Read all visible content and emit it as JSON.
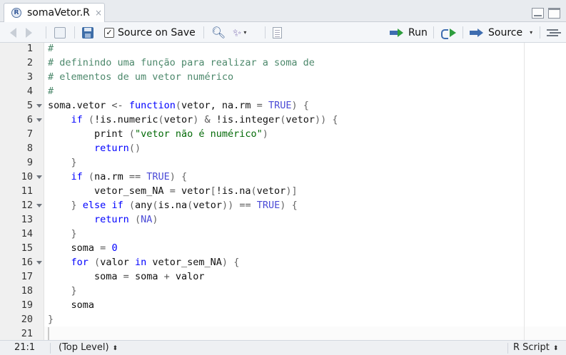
{
  "tab": {
    "icon_letter": "R",
    "title": "somaVetor.R",
    "close_glyph": "×"
  },
  "toolbar": {
    "source_on_save_label": "Source on Save",
    "source_on_save_checked": "✓",
    "run_label": "Run",
    "source_label": "Source",
    "dropdown_caret": "▾"
  },
  "editor": {
    "lines": [
      {
        "num": "1",
        "fold": false,
        "tokens": [
          [
            "c-comment",
            "#"
          ]
        ]
      },
      {
        "num": "2",
        "fold": false,
        "tokens": [
          [
            "c-comment",
            "# definindo uma função para realizar a soma de"
          ]
        ]
      },
      {
        "num": "3",
        "fold": false,
        "tokens": [
          [
            "c-comment",
            "# elementos de um vetor numérico"
          ]
        ]
      },
      {
        "num": "4",
        "fold": false,
        "tokens": [
          [
            "c-comment",
            "#"
          ]
        ]
      },
      {
        "num": "5",
        "fold": true,
        "tokens": [
          [
            "",
            "soma.vetor "
          ],
          [
            "c-op",
            "<-"
          ],
          [
            "",
            " "
          ],
          [
            "c-kw",
            "function"
          ],
          [
            "c-punc",
            "("
          ],
          [
            "",
            "vetor, na.rm "
          ],
          [
            "c-op",
            "="
          ],
          [
            "",
            " "
          ],
          [
            "c-const",
            "TRUE"
          ],
          [
            "c-punc",
            ")"
          ],
          [
            "",
            " "
          ],
          [
            "c-punc",
            "{"
          ]
        ]
      },
      {
        "num": "6",
        "fold": true,
        "tokens": [
          [
            "",
            "    "
          ],
          [
            "c-kw",
            "if"
          ],
          [
            "",
            " "
          ],
          [
            "c-punc",
            "("
          ],
          [
            "",
            "!is.numeric"
          ],
          [
            "c-punc",
            "("
          ],
          [
            "",
            "vetor"
          ],
          [
            "c-punc",
            ")"
          ],
          [
            "",
            " "
          ],
          [
            "c-op",
            "&"
          ],
          [
            "",
            " !is.integer"
          ],
          [
            "c-punc",
            "("
          ],
          [
            "",
            "vetor"
          ],
          [
            "c-punc",
            "))"
          ],
          [
            "",
            " "
          ],
          [
            "c-punc",
            "{"
          ]
        ]
      },
      {
        "num": "7",
        "fold": false,
        "tokens": [
          [
            "",
            "        print "
          ],
          [
            "c-punc",
            "("
          ],
          [
            "c-str",
            "\"vetor não é numérico\""
          ],
          [
            "c-punc",
            ")"
          ]
        ]
      },
      {
        "num": "8",
        "fold": false,
        "tokens": [
          [
            "",
            "        "
          ],
          [
            "c-kw",
            "return"
          ],
          [
            "c-punc",
            "()"
          ]
        ]
      },
      {
        "num": "9",
        "fold": false,
        "tokens": [
          [
            "",
            "    "
          ],
          [
            "c-punc",
            "}"
          ]
        ]
      },
      {
        "num": "10",
        "fold": true,
        "tokens": [
          [
            "",
            "    "
          ],
          [
            "c-kw",
            "if"
          ],
          [
            "",
            " "
          ],
          [
            "c-punc",
            "("
          ],
          [
            "",
            "na.rm "
          ],
          [
            "c-op",
            "=="
          ],
          [
            "",
            " "
          ],
          [
            "c-const",
            "TRUE"
          ],
          [
            "c-punc",
            ")"
          ],
          [
            "",
            " "
          ],
          [
            "c-punc",
            "{"
          ]
        ]
      },
      {
        "num": "11",
        "fold": false,
        "tokens": [
          [
            "",
            "        vetor_sem_NA "
          ],
          [
            "c-op",
            "="
          ],
          [
            "",
            " vetor"
          ],
          [
            "c-punc",
            "["
          ],
          [
            "",
            "!is.na"
          ],
          [
            "c-punc",
            "("
          ],
          [
            "",
            "vetor"
          ],
          [
            "c-punc",
            ")]"
          ]
        ]
      },
      {
        "num": "12",
        "fold": true,
        "tokens": [
          [
            "",
            "    "
          ],
          [
            "c-punc",
            "}"
          ],
          [
            "",
            " "
          ],
          [
            "c-kw",
            "else"
          ],
          [
            "",
            " "
          ],
          [
            "c-kw",
            "if"
          ],
          [
            "",
            " "
          ],
          [
            "c-punc",
            "("
          ],
          [
            "",
            "any"
          ],
          [
            "c-punc",
            "("
          ],
          [
            "",
            "is.na"
          ],
          [
            "c-punc",
            "("
          ],
          [
            "",
            "vetor"
          ],
          [
            "c-punc",
            "))"
          ],
          [
            "",
            " "
          ],
          [
            "c-op",
            "=="
          ],
          [
            "",
            " "
          ],
          [
            "c-const",
            "TRUE"
          ],
          [
            "c-punc",
            ")"
          ],
          [
            "",
            " "
          ],
          [
            "c-punc",
            "{"
          ]
        ]
      },
      {
        "num": "13",
        "fold": false,
        "tokens": [
          [
            "",
            "        "
          ],
          [
            "c-kw",
            "return"
          ],
          [
            "",
            " "
          ],
          [
            "c-punc",
            "("
          ],
          [
            "c-const",
            "NA"
          ],
          [
            "c-punc",
            ")"
          ]
        ]
      },
      {
        "num": "14",
        "fold": false,
        "tokens": [
          [
            "",
            "    "
          ],
          [
            "c-punc",
            "}"
          ]
        ]
      },
      {
        "num": "15",
        "fold": false,
        "tokens": [
          [
            "",
            "    soma "
          ],
          [
            "c-op",
            "="
          ],
          [
            "",
            " "
          ],
          [
            "c-num",
            "0"
          ]
        ]
      },
      {
        "num": "16",
        "fold": true,
        "tokens": [
          [
            "",
            "    "
          ],
          [
            "c-kw",
            "for"
          ],
          [
            "",
            " "
          ],
          [
            "c-punc",
            "("
          ],
          [
            "",
            "valor "
          ],
          [
            "c-kw",
            "in"
          ],
          [
            "",
            " vetor_sem_NA"
          ],
          [
            "c-punc",
            ")"
          ],
          [
            "",
            " "
          ],
          [
            "c-punc",
            "{"
          ]
        ]
      },
      {
        "num": "17",
        "fold": false,
        "tokens": [
          [
            "",
            "        soma "
          ],
          [
            "c-op",
            "="
          ],
          [
            "",
            " soma "
          ],
          [
            "c-op",
            "+"
          ],
          [
            "",
            " valor"
          ]
        ]
      },
      {
        "num": "18",
        "fold": false,
        "tokens": [
          [
            "",
            "    "
          ],
          [
            "c-punc",
            "}"
          ]
        ]
      },
      {
        "num": "19",
        "fold": false,
        "tokens": [
          [
            "",
            "    soma"
          ]
        ]
      },
      {
        "num": "20",
        "fold": false,
        "tokens": [
          [
            "c-punc",
            "}"
          ]
        ]
      },
      {
        "num": "21",
        "fold": false,
        "tokens": []
      }
    ]
  },
  "statusbar": {
    "cursor_position": "21:1",
    "scope": "(Top Level)",
    "scope_caret": "⬍",
    "file_type": "R Script",
    "file_type_caret": "⬍"
  }
}
